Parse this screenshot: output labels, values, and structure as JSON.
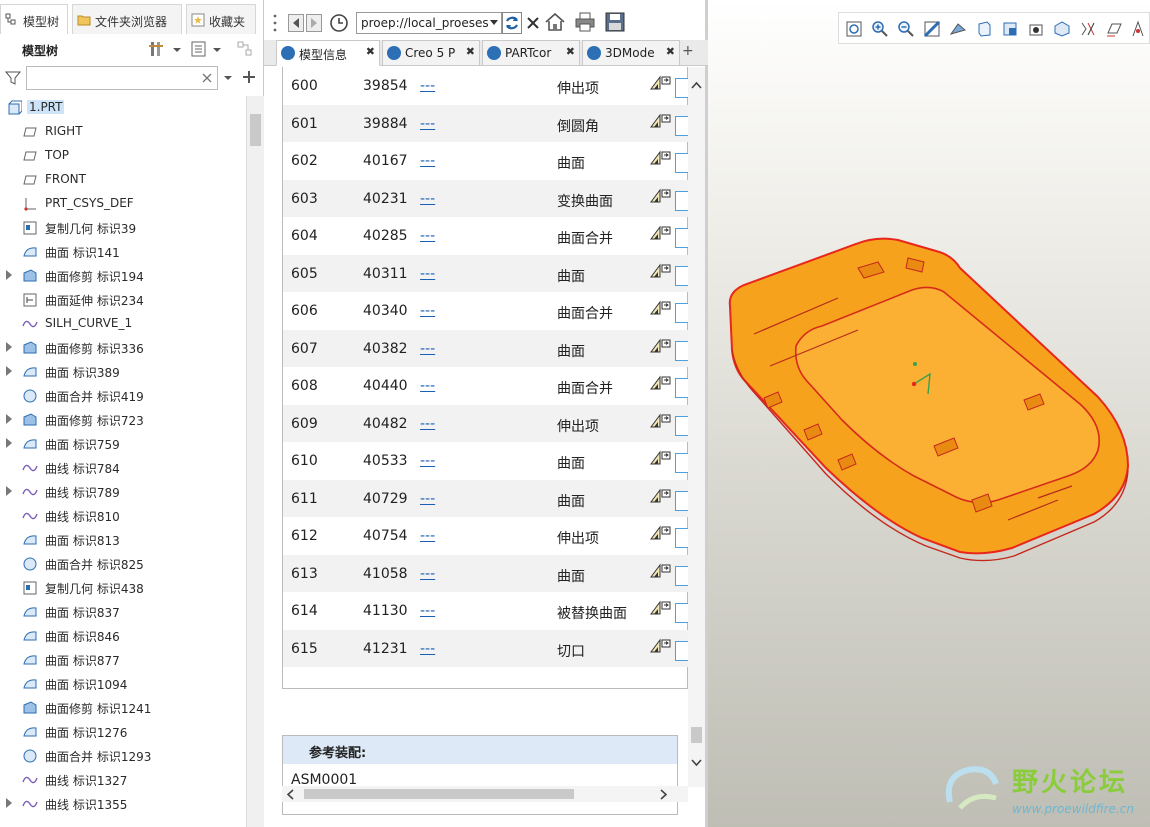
{
  "left_panel": {
    "tabs": [
      {
        "label": "模型树",
        "icon": "model-tree-icon"
      },
      {
        "label": "文件夹浏览器",
        "icon": "folder-icon"
      },
      {
        "label": "收藏夹",
        "icon": "favorites-icon"
      }
    ],
    "title": "模型树",
    "filter_value": "",
    "tree": [
      {
        "label": "1.PRT",
        "icon": "part-icon",
        "expandable": false,
        "selected": true
      },
      {
        "label": "RIGHT",
        "icon": "datum-plane-icon",
        "expandable": false
      },
      {
        "label": "TOP",
        "icon": "datum-plane-icon",
        "expandable": false
      },
      {
        "label": "FRONT",
        "icon": "datum-plane-icon",
        "expandable": false
      },
      {
        "label": "PRT_CSYS_DEF",
        "icon": "csys-icon",
        "expandable": false
      },
      {
        "label": "复制几何 标识39",
        "icon": "copy-geometry-icon",
        "expandable": false
      },
      {
        "label": "曲面 标识141",
        "icon": "surface-icon",
        "expandable": false
      },
      {
        "label": "曲面修剪 标识194",
        "icon": "surface-trim-icon",
        "expandable": true
      },
      {
        "label": "曲面延伸 标识234",
        "icon": "surface-extend-icon",
        "expandable": false
      },
      {
        "label": "SILH_CURVE_1",
        "icon": "curve-icon",
        "expandable": false
      },
      {
        "label": "曲面修剪 标识336",
        "icon": "surface-trim-icon",
        "expandable": true
      },
      {
        "label": "曲面 标识389",
        "icon": "surface-icon",
        "expandable": true
      },
      {
        "label": "曲面合并 标识419",
        "icon": "surface-merge-icon",
        "expandable": false
      },
      {
        "label": "曲面修剪 标识723",
        "icon": "surface-trim-icon",
        "expandable": true
      },
      {
        "label": "曲面 标识759",
        "icon": "surface-icon",
        "expandable": true
      },
      {
        "label": "曲线 标识784",
        "icon": "curve-icon",
        "expandable": false
      },
      {
        "label": "曲线 标识789",
        "icon": "curve-icon",
        "expandable": true
      },
      {
        "label": "曲线 标识810",
        "icon": "curve-icon",
        "expandable": false
      },
      {
        "label": "曲面 标识813",
        "icon": "surface-icon",
        "expandable": false
      },
      {
        "label": "曲面合并 标识825",
        "icon": "surface-merge-icon",
        "expandable": false
      },
      {
        "label": "复制几何 标识438",
        "icon": "copy-geometry-icon",
        "expandable": false
      },
      {
        "label": "曲面 标识837",
        "icon": "surface-icon",
        "expandable": false
      },
      {
        "label": "曲面 标识846",
        "icon": "surface-icon",
        "expandable": false
      },
      {
        "label": "曲面 标识877",
        "icon": "surface-icon",
        "expandable": false
      },
      {
        "label": "曲面 标识1094",
        "icon": "surface-icon",
        "expandable": false
      },
      {
        "label": "曲面修剪 标识1241",
        "icon": "surface-trim-icon",
        "expandable": false
      },
      {
        "label": "曲面 标识1276",
        "icon": "surface-icon",
        "expandable": false
      },
      {
        "label": "曲面合并 标识1293",
        "icon": "surface-merge-icon",
        "expandable": false
      },
      {
        "label": "曲线 标识1327",
        "icon": "curve-icon",
        "expandable": false
      },
      {
        "label": "曲线 标识1355",
        "icon": "curve-icon",
        "expandable": true
      }
    ]
  },
  "browser": {
    "url": "proep://local_proeses",
    "tabs": [
      {
        "label": "模型信息",
        "active": true
      },
      {
        "label": "Creo 5 P",
        "active": false
      },
      {
        "label": "PARTcor",
        "active": false
      },
      {
        "label": "3DMode",
        "active": false
      }
    ],
    "add_tab_label": "+",
    "close_glyph": "✖",
    "features": [
      {
        "no": "600",
        "id": "39854",
        "name": "---",
        "type": "伸出项"
      },
      {
        "no": "601",
        "id": "39884",
        "name": "---",
        "type": "倒圆角"
      },
      {
        "no": "602",
        "id": "40167",
        "name": "---",
        "type": "曲面"
      },
      {
        "no": "603",
        "id": "40231",
        "name": "---",
        "type": "变换曲面"
      },
      {
        "no": "604",
        "id": "40285",
        "name": "---",
        "type": "曲面合并"
      },
      {
        "no": "605",
        "id": "40311",
        "name": "---",
        "type": "曲面"
      },
      {
        "no": "606",
        "id": "40340",
        "name": "---",
        "type": "曲面合并"
      },
      {
        "no": "607",
        "id": "40382",
        "name": "---",
        "type": "曲面"
      },
      {
        "no": "608",
        "id": "40440",
        "name": "---",
        "type": "曲面合并"
      },
      {
        "no": "609",
        "id": "40482",
        "name": "---",
        "type": "伸出项"
      },
      {
        "no": "610",
        "id": "40533",
        "name": "---",
        "type": "曲面"
      },
      {
        "no": "611",
        "id": "40729",
        "name": "---",
        "type": "曲面"
      },
      {
        "no": "612",
        "id": "40754",
        "name": "---",
        "type": "伸出项"
      },
      {
        "no": "613",
        "id": "41058",
        "name": "---",
        "type": "曲面"
      },
      {
        "no": "614",
        "id": "41130",
        "name": "---",
        "type": "被替换曲面"
      },
      {
        "no": "615",
        "id": "41231",
        "name": "---",
        "type": "切口"
      }
    ],
    "reference": {
      "heading": "参考装配:",
      "value": "ASM0001"
    }
  },
  "viewport": {
    "model_color": "#f7a21c",
    "edge_color": "#e8261b",
    "watermark": {
      "name": "野火论坛",
      "url": "www.proewildfire.cn"
    }
  }
}
